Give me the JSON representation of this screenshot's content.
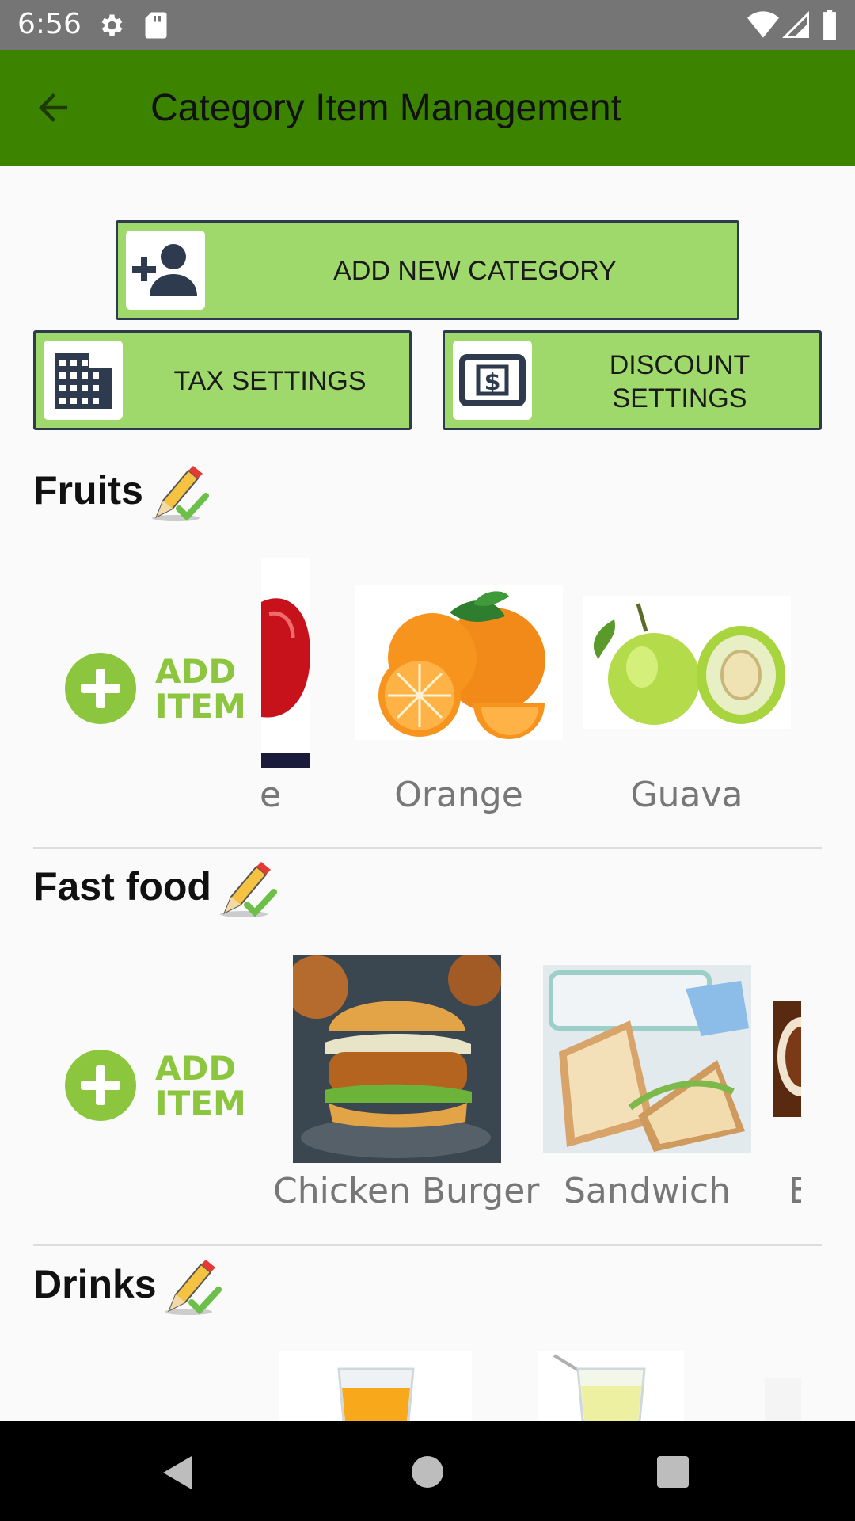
{
  "status_bar": {
    "time": "6:56"
  },
  "app_bar": {
    "title": "Category Item Management"
  },
  "actions": {
    "add_category": "ADD NEW CATEGORY",
    "tax_settings": "TAX SETTINGS",
    "discount_settings_line1": "DISCOUNT",
    "discount_settings_line2": "SETTINGS"
  },
  "add_item": {
    "line1": "ADD",
    "line2": "ITEM"
  },
  "categories": [
    {
      "name": "Fruits",
      "items": [
        "e",
        "Orange",
        "Guava"
      ]
    },
    {
      "name": "Fast food",
      "items": [
        "Chicken Burger",
        "Sandwich",
        "E"
      ]
    },
    {
      "name": "Drinks",
      "items": []
    }
  ],
  "colors": {
    "app_bar": "#3c8400",
    "button_fill": "#a0d96b",
    "add_item": "#8cc63f"
  }
}
